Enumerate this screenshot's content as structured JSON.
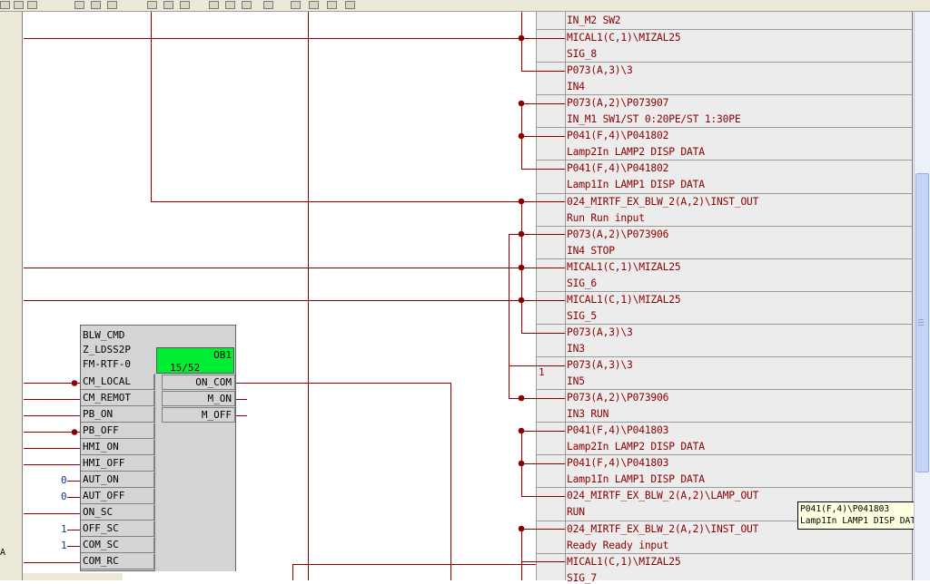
{
  "toolbar": {
    "icons": [
      "new-icon",
      "open-icon",
      "print-icon",
      "cut-icon",
      "copy-icon",
      "paste-icon",
      "properties-icon",
      "catalog-icon",
      "compile-icon",
      "download-icon",
      "undo-icon",
      "redo-icon",
      "insert-icon",
      "zoom-in-icon",
      "zoom-out-icon",
      "window-icon",
      "help-icon"
    ]
  },
  "block": {
    "title_lines": [
      "BLW_CMD",
      "Z_LDSS2P",
      "FM-RTF-0"
    ],
    "ob_label": "OB1",
    "ob_number": "15/52",
    "inputs": [
      "CM_LOCAL",
      "CM_REMOT",
      "PB_ON",
      "PB_OFF",
      "HMI_ON",
      "HMI_OFF",
      "AUT_ON",
      "AUT_OFF",
      "ON_SC",
      "OFF_SC",
      "COM_SC",
      "COM_RC"
    ],
    "outputs": [
      "ON_COM",
      "M_ON",
      "M_OFF"
    ],
    "constants": [
      {
        "pin": "AUT_ON",
        "value": "0"
      },
      {
        "pin": "AUT_OFF",
        "value": "0"
      },
      {
        "pin": "OFF_SC",
        "value": "1"
      },
      {
        "pin": "COM_SC",
        "value": "1"
      }
    ]
  },
  "rows": [
    {
      "line1": "IN_M2 SW2"
    },
    {
      "line1": "MICAL1(C,1)\\MIZAL25",
      "line2": "SIG_8"
    },
    {
      "line1": "P073(A,3)\\3",
      "line2": "IN4"
    },
    {
      "line1": "P073(A,2)\\P073907",
      "line2": "IN_M1 SW1/ST 0:20PE/ST 1:30PE"
    },
    {
      "line1": "P041(F,4)\\P041802",
      "line2": "Lamp2In LAMP2 DISP DATA"
    },
    {
      "line1": "P041(F,4)\\P041802",
      "line2": "Lamp1In LAMP1 DISP DATA"
    },
    {
      "line1": "024_MIRTF_EX_BLW_2(A,2)\\INST_OUT",
      "line2": "Run Run input"
    },
    {
      "line1": "P073(A,2)\\P073906",
      "line2": "IN4 STOP"
    },
    {
      "line1": "MICAL1(C,1)\\MIZAL25",
      "line2": "SIG_6"
    },
    {
      "line1": "MICAL1(C,1)\\MIZAL25",
      "line2": "SIG_5"
    },
    {
      "line1": "P073(A,3)\\3",
      "line2": "IN3"
    },
    {
      "line1": "P073(A,3)\\3",
      "line2": "IN5"
    },
    {
      "line1": "P073(A,2)\\P073906",
      "line2": "IN3 RUN"
    },
    {
      "line1": "P041(F,4)\\P041803",
      "line2": "Lamp2In LAMP2 DISP DATA"
    },
    {
      "line1": "P041(F,4)\\P041803",
      "line2": "Lamp1In LAMP1 DISP DATA"
    },
    {
      "line1": "024_MIRTF_EX_BLW_2(A,2)\\LAMP_OUT",
      "line2": "RUN"
    },
    {
      "line1": "024_MIRTF_EX_BLW_2(A,2)\\INST_OUT",
      "line2": "Ready Ready input"
    },
    {
      "line1": "MICAL1(C,1)\\MIZAL25",
      "line2": "SIG_7"
    }
  ],
  "sheet_marker": "1",
  "tooltip": {
    "line1": "P041(F,4)\\P041803",
    "line2": "Lamp1In LAMP1 DISP DATA"
  },
  "colors": {
    "wire": "#8b0000",
    "ob_box": "#00ee33",
    "panel": "#ececec",
    "constant": "#1c2f9c"
  }
}
